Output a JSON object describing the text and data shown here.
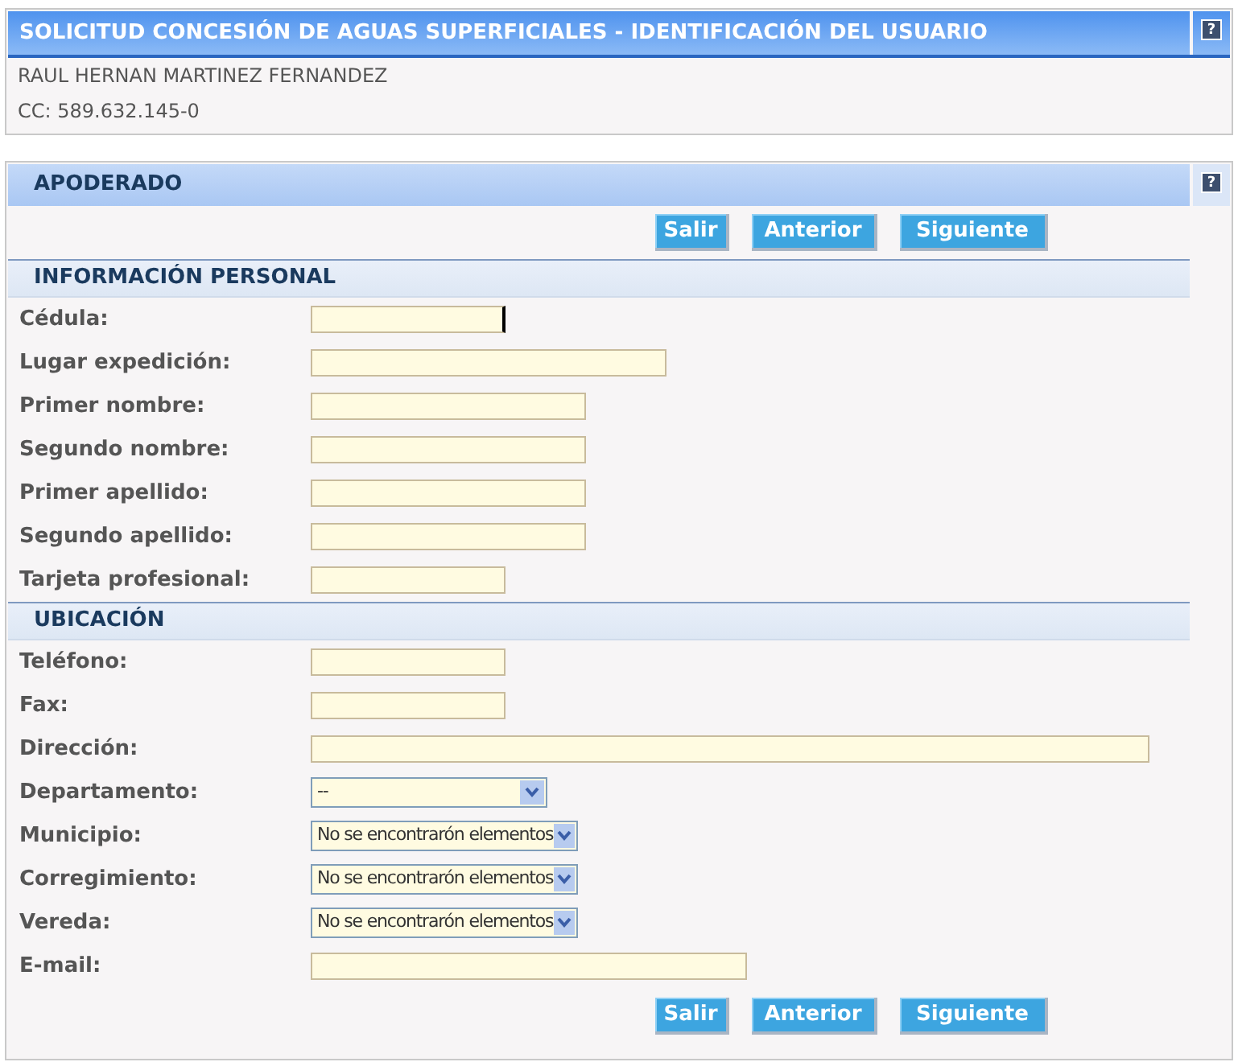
{
  "header": {
    "title": "SOLICITUD CONCESIÓN DE AGUAS SUPERFICIALES - IDENTIFICACIÓN DEL USUARIO",
    "help": "?",
    "user_name": "RAUL HERNAN MARTINEZ FERNANDEZ",
    "user_id": "CC: 589.632.145-0"
  },
  "form": {
    "title": "APODERADO",
    "help": "?",
    "buttons_top": [
      "Salir",
      "Anterior",
      "Siguiente"
    ],
    "sections": [
      {
        "title": "INFORMACIÓN PERSONAL",
        "fields": [
          {
            "label": "Cédula:",
            "kind": "text",
            "focused": true
          },
          {
            "label": "Lugar expedición:",
            "kind": "text",
            "focused": false
          },
          {
            "label": "Primer nombre:",
            "kind": "text",
            "focused": false
          },
          {
            "label": "Segundo nombre:",
            "kind": "text",
            "focused": false
          },
          {
            "label": "Primer apellido:",
            "kind": "text",
            "focused": false
          },
          {
            "label": "Segundo apellido:",
            "kind": "text",
            "focused": false
          },
          {
            "label": "Tarjeta profesional:",
            "kind": "text",
            "focused": false
          }
        ]
      },
      {
        "title": "UBICACIÓN",
        "fields": [
          {
            "label": "Teléfono:",
            "kind": "text",
            "focused": false
          },
          {
            "label": "Fax:",
            "kind": "text",
            "focused": false
          },
          {
            "label": "Dirección:",
            "kind": "text",
            "focused": false
          },
          {
            "label": "Departamento:",
            "kind": "select",
            "value": "--"
          },
          {
            "label": "Municipio:",
            "kind": "select",
            "value": "No se encontrarón elementos"
          },
          {
            "label": "Corregimiento:",
            "kind": "select",
            "value": "No se encontrarón elementos"
          },
          {
            "label": "Vereda:",
            "kind": "select",
            "value": "No se encontrarón elementos"
          },
          {
            "label": "E-mail:",
            "kind": "text",
            "focused": false
          }
        ]
      }
    ],
    "buttons_bottom": [
      "Salir",
      "Anterior",
      "Siguiente"
    ]
  }
}
